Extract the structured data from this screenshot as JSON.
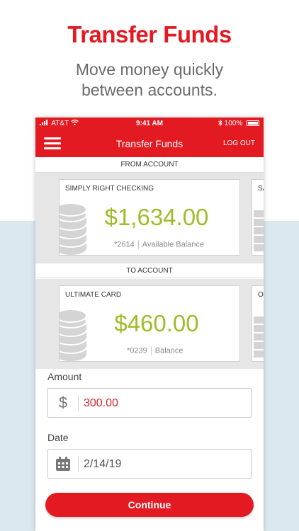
{
  "promo": {
    "title": "Transfer Funds",
    "subtitle_line1": "Move money quickly",
    "subtitle_line2": "between accounts."
  },
  "status_bar": {
    "carrier": "AT&T",
    "time": "9:41 AM",
    "battery": "100%"
  },
  "nav": {
    "title": "Transfer Funds",
    "logout_label": "LOG OUT",
    "menu_icon": "hamburger-icon"
  },
  "from_account": {
    "section_label": "FROM ACCOUNT",
    "name": "SIMPLY RIGHT CHECKING",
    "amount": "$1,634.00",
    "last4": "*2614",
    "balance_label": "Available Balance",
    "peek_label": "SA"
  },
  "to_account": {
    "section_label": "TO ACCOUNT",
    "name": "ULTIMATE CARD",
    "amount": "$460.00",
    "last4": "*0239",
    "balance_label": "Balance",
    "peek_label": "O"
  },
  "form": {
    "amount_label": "Amount",
    "amount_symbol": "$",
    "amount_value": "300.00",
    "date_label": "Date",
    "date_value": "2/14/19"
  },
  "actions": {
    "continue_label": "Continue"
  },
  "colors": {
    "brand_red": "#e31a22",
    "balance_green": "#9dbd28",
    "amount_red": "#d9242b",
    "background_blue": "#dbe9ee"
  }
}
